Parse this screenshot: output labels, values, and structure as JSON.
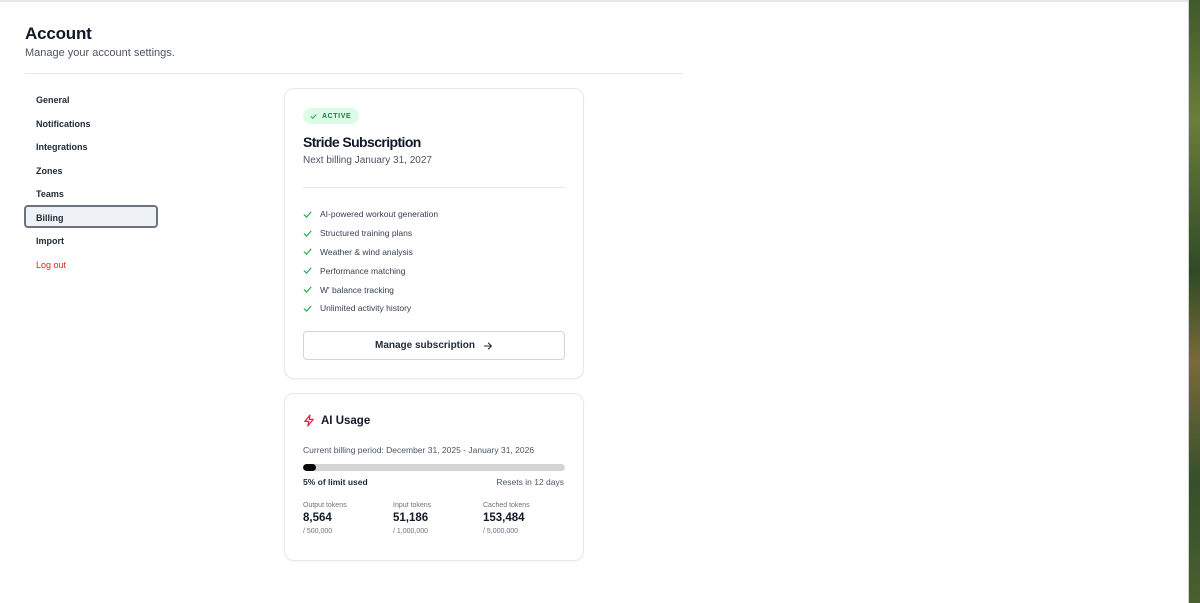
{
  "header": {
    "title": "Account",
    "subtitle": "Manage your account settings."
  },
  "sidebar": {
    "items": [
      {
        "label": "General",
        "active": false
      },
      {
        "label": "Notifications",
        "active": false
      },
      {
        "label": "Integrations",
        "active": false
      },
      {
        "label": "Zones",
        "active": false
      },
      {
        "label": "Teams",
        "active": false
      },
      {
        "label": "Billing",
        "active": true
      },
      {
        "label": "Import",
        "active": false
      },
      {
        "label": "Log out",
        "active": false
      }
    ]
  },
  "subscription": {
    "status": "ACTIVE",
    "plan_name": "Stride Subscription",
    "next_billing": "Next billing January 31, 2027",
    "features": [
      "AI-powered workout generation",
      "Structured training plans",
      "Weather & wind analysis",
      "Performance matching",
      "W' balance tracking",
      "Unlimited activity history"
    ],
    "manage_label": "Manage subscription"
  },
  "ai_usage": {
    "title": "AI Usage",
    "period": "Current billing period: December 31, 2025 - January 31, 2026",
    "percent_used": 5,
    "used_label": "5% of limit used",
    "resets_label": "Resets in 12 days",
    "stats": [
      {
        "label": "Output tokens",
        "value": "8,564",
        "limit": "/ 500,000"
      },
      {
        "label": "Input tokens",
        "value": "51,186",
        "limit": "/ 1,000,000"
      },
      {
        "label": "Cached tokens",
        "value": "153,484",
        "limit": "/ 5,000,000"
      }
    ]
  },
  "colors": {
    "accent_green": "#16a34a",
    "badge_bg": "#dcfce7",
    "danger": "#dc2626",
    "bolt": "#e11d48",
    "progress_fill": "#0a0a0a",
    "progress_track": "#d4d4d4"
  },
  "icons": {
    "badge": "check-icon",
    "feature": "check-icon",
    "manage": "arrow-right-icon",
    "ai": "lightning-icon"
  }
}
